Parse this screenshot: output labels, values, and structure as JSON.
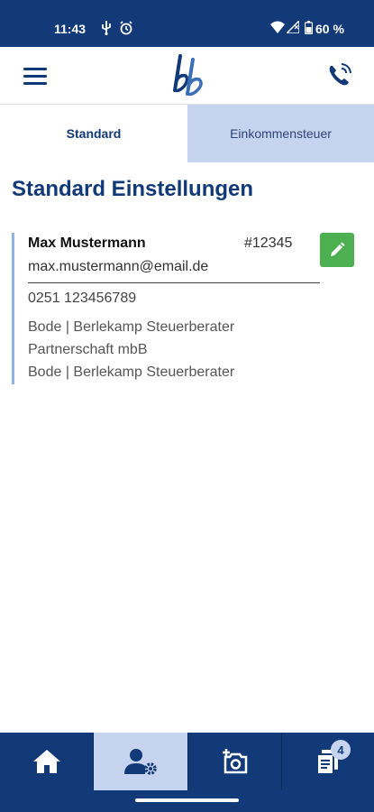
{
  "status_bar": {
    "time": "11:43",
    "battery": "60 %",
    "icons": [
      "usb-icon",
      "alarm-icon",
      "wifi-icon",
      "signal-icon",
      "battery-icon"
    ]
  },
  "app_bar": {
    "menu_icon": "hamburger-menu-icon",
    "logo_icon": "bb-logo-icon",
    "call_icon": "phone-call-icon"
  },
  "tabs": [
    {
      "label": "Standard",
      "active": true
    },
    {
      "label": "Einkommensteuer",
      "active": false
    }
  ],
  "page": {
    "title": "Standard Einstellungen"
  },
  "contact_card": {
    "name": "Max Mustermann",
    "client_number": "#12345",
    "email": "max.mustermann@email.de",
    "phone": "0251 123456789",
    "company_line1": "Bode | Berlekamp Steuerberater",
    "company_line2": "Partnerschaft mbB",
    "company_line3": "Bode | Berlekamp Steuerberater",
    "edit_icon": "pencil-icon"
  },
  "bottom_nav": {
    "items": [
      {
        "icon": "home-icon",
        "active": false
      },
      {
        "icon": "user-settings-icon",
        "active": true
      },
      {
        "icon": "camera-add-icon",
        "active": false
      },
      {
        "icon": "documents-icon",
        "active": false,
        "badge": "4"
      }
    ]
  },
  "colors": {
    "primary": "#123a78",
    "tab_inactive": "#c7d4ef",
    "edit_button": "#4caf50",
    "card_accent": "#8fb2e0"
  }
}
